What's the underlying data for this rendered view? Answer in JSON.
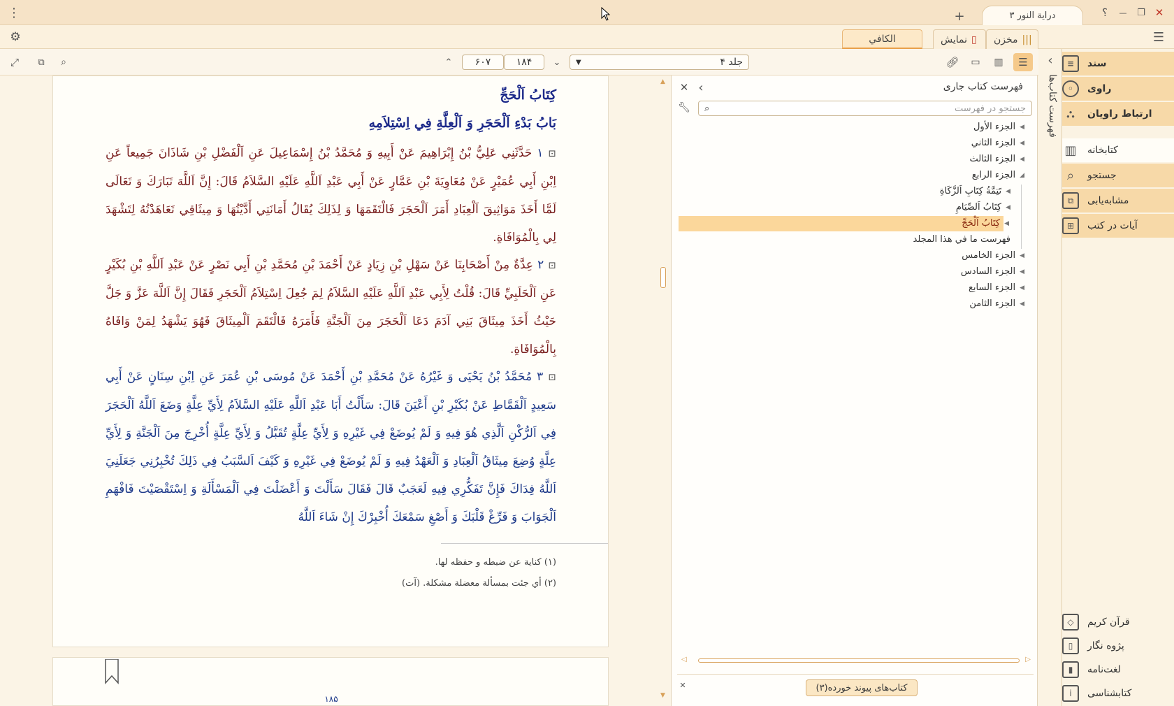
{
  "titlebar": {
    "doc_tab": "دراية النور ۳",
    "new_tab": "+",
    "help": "؟",
    "minimize": "—",
    "restore": "❐",
    "close": "✕",
    "menu_dots": "⋮"
  },
  "tabbar": {
    "tabs": [
      {
        "label": "مخزن"
      },
      {
        "label": "نمایش"
      }
    ],
    "active_book_tab": "الكافي"
  },
  "toolbar": {
    "volume": "جلد ۴",
    "page_current": "۱۸۴",
    "page_total": "۶۰۷"
  },
  "reader": {
    "book_title": "كِتَابُ اَلْحَجِّ",
    "chapter_title": "بَابُ بَدْءِ اَلْحَجَرِ وَ اَلْعِلَّةِ فِي اِسْتِلاَمِهِ",
    "hadiths": [
      {
        "num": "۱",
        "text": "حَدَّثَنِي عَلِيُّ بْنُ إِبْرَاهِيمَ عَنْ أَبِيهِ وَ مُحَمَّدُ بْنُ إِسْمَاعِيلَ عَنِ اَلْفَضْلِ بْنِ شَاذَانَ جَمِيعاً عَنِ اِبْنِ أَبِي عُمَيْرٍ عَنْ مُعَاوِيَةَ بْنِ عَمَّارٍ عَنْ أَبِي عَبْدِ اَللَّهِ عَلَيْهِ السَّلاَمُ قَالَ: إِنَّ اَللَّهَ تَبَارَكَ وَ تَعَالَى لَمَّا أَخَذَ مَوَاثِيقَ اَلْعِبَادِ أَمَرَ اَلْحَجَرَ فَالْتَقَمَهَا وَ لِذَلِكَ يُقَالُ أَمَانَتِي أَدَّيْتُهَا وَ مِيثَاقِي تَعَاهَدْتُهُ لِتَشْهَدَ لِي بِالْمُوَافَاةِ."
      },
      {
        "num": "۲",
        "text": "عِدَّةٌ مِنْ أَصْحَابِنَا عَنْ سَهْلِ بْنِ زِيَادٍ عَنْ أَحْمَدَ بْنِ مُحَمَّدِ بْنِ أَبِي نَصْرٍ عَنْ عَبْدِ اَللَّهِ بْنِ بُكَيْرٍ عَنِ اَلْحَلَبِيِّ قَالَ: قُلْتُ لِأَبِي عَبْدِ اَللَّهِ عَلَيْهِ السَّلاَمُ لِمَ جُعِلَ اِسْتِلاَمُ اَلْحَجَرِ فَقَالَ إِنَّ اَللَّهَ عَزَّ وَ جَلَّ حَيْثُ أَخَذَ مِيثَاقَ بَنِي آدَمَ دَعَا اَلْحَجَرَ مِنَ اَلْجَنَّةِ فَأَمَرَهُ فَالْتَقَمَ اَلْمِيثَاقَ فَهُوَ يَشْهَدُ لِمَنْ وَافَاهُ بِالْمُوَافَاةِ."
      },
      {
        "num": "۳",
        "text": "مُحَمَّدُ بْنُ يَحْيَى وَ غَيْرُهُ عَنْ مُحَمَّدِ بْنِ أَحْمَدَ عَنْ مُوسَى بْنِ عُمَرَ عَنِ اِبْنِ سِنَانٍ عَنْ أَبِي سَعِيدٍ اَلْقَمَّاطِ عَنْ بُكَيْرِ بْنِ أَعْيَنَ قَالَ: سَأَلْتُ أَبَا عَبْدِ اَللَّهِ عَلَيْهِ السَّلاَمُ لِأَيِّ عِلَّةٍ وَضَعَ اَللَّهُ اَلْحَجَرَ فِي اَلرُّكْنِ اَلَّذِي هُوَ فِيهِ وَ لَمْ يُوضَعْ فِي غَيْرِهِ وَ لِأَيِّ عِلَّةٍ تُقَبَّلُ وَ لِأَيِّ عِلَّةٍ أُخْرِجَ مِنَ اَلْجَنَّةِ وَ لِأَيِّ عِلَّةٍ وُضِعَ مِيثَاقُ اَلْعِبَادِ وَ اَلْعَهْدُ فِيهِ وَ لَمْ يُوضَعْ فِي غَيْرِهِ وَ كَيْفَ اَلسَّبَبُ فِي ذَلِكَ تُخْبِرُنِي جَعَلَنِيَ اَللَّهُ فِدَاكَ فَإِنَّ تَفَكُّرِي فِيهِ لَعَجَبٌ قَالَ فَقَالَ سَأَلْتَ وَ أَعْضَلْتَ فِي اَلْمَسْأَلَةِ وَ اِسْتَقْصَيْتَ فَافْهَمِ اَلْجَوَابَ وَ فَرِّغْ قَلْبَكَ وَ أَصْغِ سَمْعَكَ أُخْبِرْكَ إِنْ شَاءَ اَللَّهُ"
      }
    ],
    "footnotes": [
      "(۱)  كناية عن ضبطه و حفظه لها.",
      "(۲)  أي جئت بمسألة معضلة مشكلة. (آت)"
    ],
    "next_page_number": "۱۸۵"
  },
  "index": {
    "title": "فهرست کتاب جاری",
    "search_placeholder": "جستجو در فهرست",
    "items": [
      {
        "label": "الجزء الأول",
        "level": 0,
        "state": "collapsed"
      },
      {
        "label": "الجزء الثاني",
        "level": 0,
        "state": "collapsed"
      },
      {
        "label": "الجزء الثالث",
        "level": 0,
        "state": "collapsed"
      },
      {
        "label": "الجزء الرابع",
        "level": 0,
        "state": "expanded"
      },
      {
        "label": "تَتِمَّةُ كِتَابِ اَلزَّكَاةِ",
        "level": 1,
        "state": "collapsed"
      },
      {
        "label": "كِتَابُ اَلصِّيَامِ",
        "level": 1,
        "state": "collapsed"
      },
      {
        "label": "كِتَابُ اَلْحَجِّ",
        "level": 1,
        "state": "selected"
      },
      {
        "label": "فهرست ما في هذا المجلد",
        "level": 1,
        "state": "leaf"
      },
      {
        "label": "الجزء الخامس",
        "level": 0,
        "state": "collapsed"
      },
      {
        "label": "الجزء السادس",
        "level": 0,
        "state": "collapsed"
      },
      {
        "label": "الجزء السابع",
        "level": 0,
        "state": "collapsed"
      },
      {
        "label": "الجزء الثامن",
        "level": 0,
        "state": "collapsed"
      }
    ],
    "linked_books": "کتاب‌های پیوند خورده(۳)"
  },
  "vertical_label": "فهرست کتاب‌ها",
  "sidebar": {
    "top": [
      {
        "label": "سند"
      },
      {
        "label": "راوی"
      },
      {
        "label": "ارتباط راویان"
      }
    ],
    "mid": [
      {
        "label": "کتابخانه"
      },
      {
        "label": "جستجو"
      },
      {
        "label": "مشابه‌یابی"
      },
      {
        "label": "آیات در کتب"
      }
    ],
    "bottom": [
      {
        "label": "قرآن کریم"
      },
      {
        "label": "پژوه نگار"
      },
      {
        "label": "لغت‌نامه"
      },
      {
        "label": "کتابشناسی"
      }
    ]
  },
  "colors": {
    "accent": "#f5c98a",
    "matn": "#7a2020",
    "heading": "#1d2a8a"
  }
}
